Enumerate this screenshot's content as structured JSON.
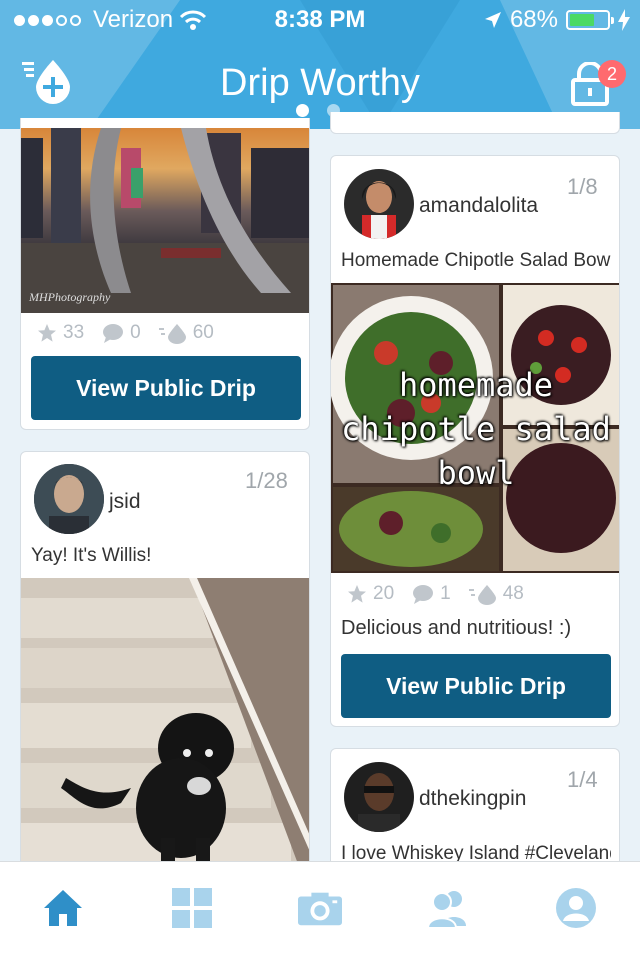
{
  "status_bar": {
    "carrier": "Verizon",
    "time": "8:38 PM",
    "battery": "68%",
    "battery_level": 0.68
  },
  "header": {
    "title": "Drip Worthy",
    "notification_count": "2",
    "pages": 2,
    "active_page": 0
  },
  "feed": {
    "left_top_card": {
      "watermark": "MHPhotography",
      "stats": {
        "stars": "33",
        "comments": "0",
        "drips": "60"
      },
      "button_label": "View Public Drip"
    },
    "jsid_card": {
      "username": "jsid",
      "count": "1/28",
      "caption": "Yay! It's Willis!"
    },
    "amandalolita_card": {
      "username": "amandalolita",
      "count": "1/8",
      "caption": "Homemade Chipotle Salad Bowl",
      "image_text": "homemade chipotle salad bowl",
      "stats": {
        "stars": "20",
        "comments": "1",
        "drips": "48"
      },
      "description": "Delicious and nutritious! :)",
      "button_label": "View Public Drip"
    },
    "dthekingpin_card": {
      "username": "dthekingpin",
      "count": "1/4",
      "caption": "I love Whiskey Island #Cleveland"
    }
  },
  "tab_bar": {
    "tabs": [
      "home",
      "grid",
      "camera",
      "friends",
      "profile"
    ],
    "active": "home"
  },
  "colors": {
    "header": "#3fa9df",
    "button": "#0f5d83",
    "tab_active": "#2f8fc8",
    "tab_inactive": "#a9d3ec",
    "badge": "#ff6a6f"
  }
}
